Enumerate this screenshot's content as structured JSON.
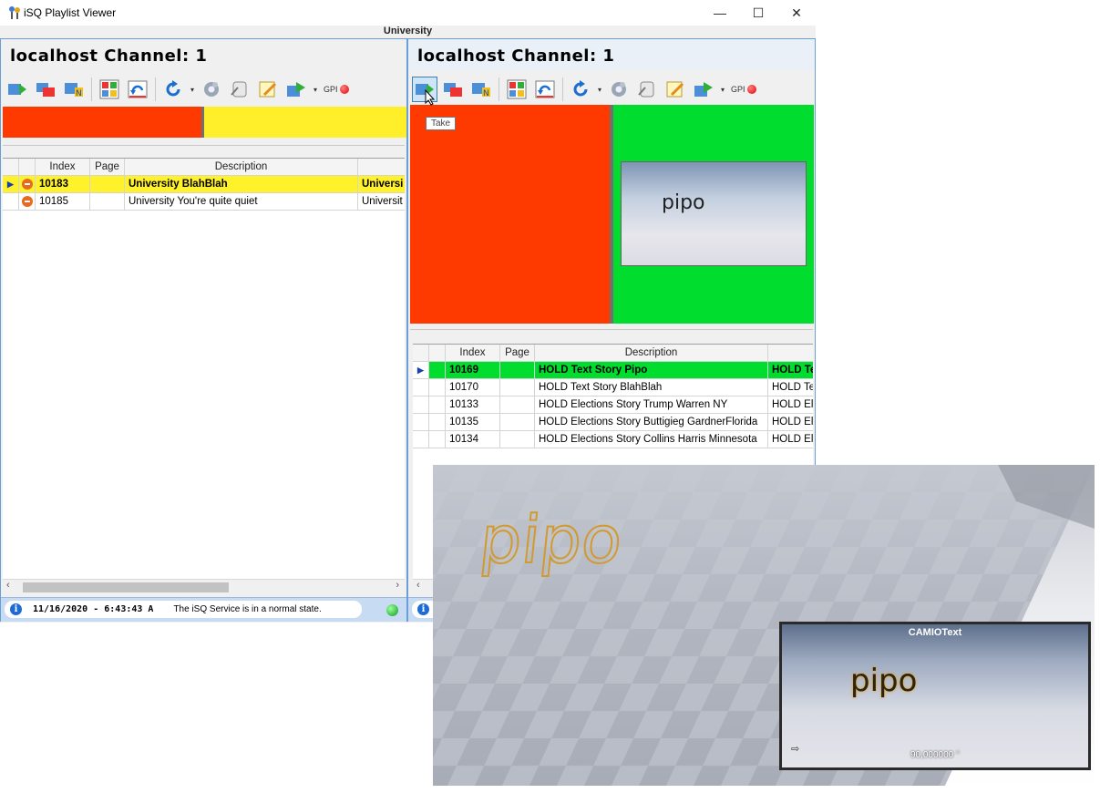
{
  "window": {
    "title": "iSQ Playlist Viewer",
    "group_title": "University",
    "controls": {
      "minimize": "—",
      "maximize": "☐",
      "close": "✕"
    }
  },
  "left_panel": {
    "channel_title": "localhost Channel: 1",
    "gpi_label": "GPI",
    "output_colors": [
      "#ff3a00",
      "#ffee2a"
    ],
    "grid": {
      "columns": [
        "Index",
        "Page",
        "Description",
        ""
      ],
      "rows": [
        {
          "index": "10183",
          "page": "",
          "description": "University BlahBlah",
          "extra": "Universi",
          "selected": true
        },
        {
          "index": "10185",
          "page": "",
          "description": "University You're quite quiet",
          "extra": "Universit",
          "selected": false
        }
      ]
    },
    "status": {
      "timestamp": "11/16/2020 - 6:43:43 A",
      "message": "The iSQ Service is in a normal state."
    }
  },
  "right_panel": {
    "channel_title": "localhost Channel: 1",
    "gpi_label": "GPI",
    "tooltip": "Take",
    "output_colors": [
      "#ff3a00",
      "#00dd2e"
    ],
    "thumbnail_text": "pipo",
    "grid": {
      "columns": [
        "Index",
        "Page",
        "Description",
        ""
      ],
      "rows": [
        {
          "index": "10169",
          "page": "",
          "description": "HOLD Text Story Pipo",
          "extra": "HOLD Te",
          "selected": true
        },
        {
          "index": "10170",
          "page": "",
          "description": "HOLD Text Story BlahBlah",
          "extra": "HOLD Te",
          "selected": false
        },
        {
          "index": "10133",
          "page": "",
          "description": "HOLD Elections Story Trump Warren NY",
          "extra": "HOLD El",
          "selected": false
        },
        {
          "index": "10135",
          "page": "",
          "description": "HOLD Elections Story Buttigieg GardnerFlorida",
          "extra": "HOLD El",
          "selected": false
        },
        {
          "index": "10134",
          "page": "",
          "description": "HOLD Elections Story Collins Harris Minnesota",
          "extra": "HOLD El",
          "selected": false
        }
      ]
    }
  },
  "preview": {
    "scene_text": "pipo",
    "camera_title": "CAMIOText",
    "camera_text": "pipo",
    "camera_readout": "90,000000 °"
  },
  "colors": {
    "selected_yellow": "#fff12a",
    "selected_green": "#00dd2e",
    "frame_blue": "#6a9ed8",
    "status_blue": "#c7dcf3"
  }
}
